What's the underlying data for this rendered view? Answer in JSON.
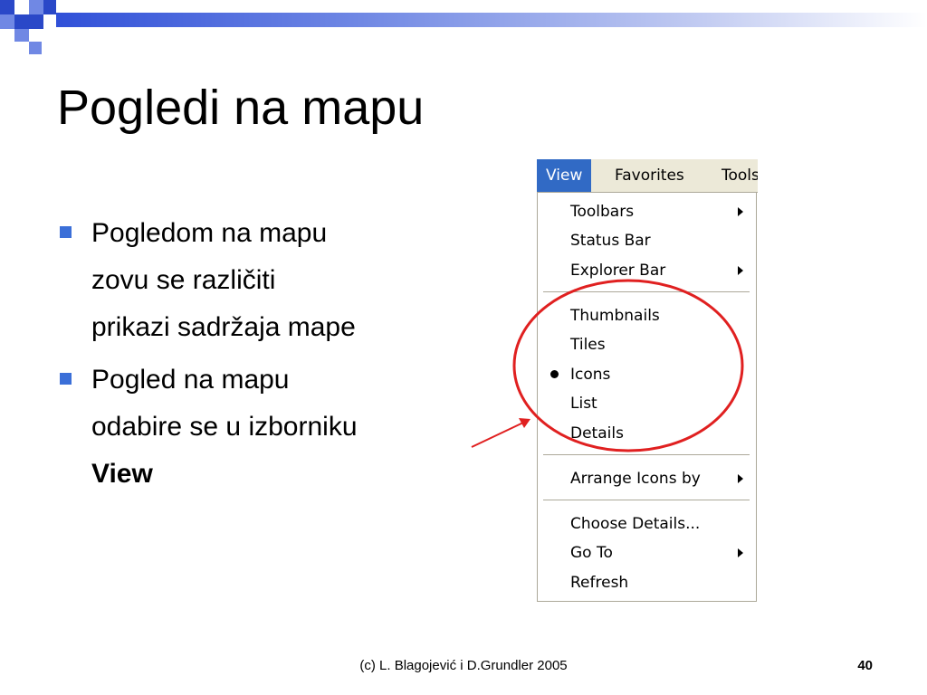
{
  "slide": {
    "title": "Pogledi na mapu",
    "bullets": [
      {
        "lines": [
          "Pogledom na mapu",
          "zovu se različiti",
          "prikazi sadržaja mape"
        ],
        "bold": ""
      },
      {
        "lines": [
          "Pogled na mapu",
          "odabire se u izborniku"
        ],
        "bold": "View"
      }
    ],
    "footer": "(c) L. Blagojević i D.Grundler 2005",
    "page_number": "40"
  },
  "menubar": {
    "items": [
      {
        "label": "View",
        "active": true
      },
      {
        "label": "Favorites",
        "active": false
      },
      {
        "label": "Tools",
        "active": false
      }
    ]
  },
  "dropdown": {
    "items": [
      {
        "label": "Toolbars",
        "submenu": true
      },
      {
        "label": "Status Bar",
        "submenu": false
      },
      {
        "label": "Explorer Bar",
        "submenu": true
      },
      {
        "label": "Thumbnails",
        "submenu": false
      },
      {
        "label": "Tiles",
        "submenu": false
      },
      {
        "label": "Icons",
        "submenu": false,
        "selected": true
      },
      {
        "label": "List",
        "submenu": false
      },
      {
        "label": "Details",
        "submenu": false
      },
      {
        "label": "Arrange Icons by",
        "submenu": true
      },
      {
        "label": "Choose Details...",
        "submenu": false
      },
      {
        "label": "Go To",
        "submenu": true
      },
      {
        "label": "Refresh",
        "submenu": false
      }
    ]
  },
  "colors": {
    "accent_blue": "#3b6fd8",
    "menu_highlight": "#316ac5",
    "annotation_red": "#e02020"
  }
}
